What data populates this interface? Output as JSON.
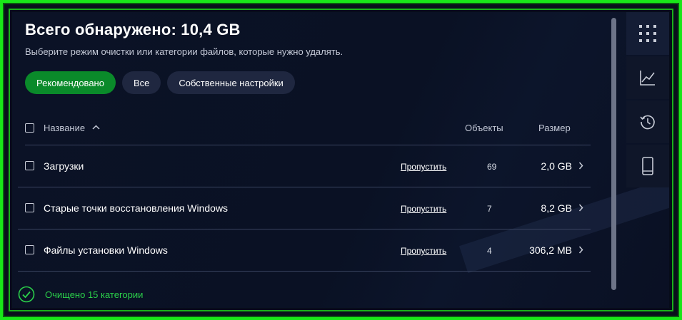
{
  "header": {
    "title": "Всего обнаружено: 10,4 GB",
    "subtitle": "Выберите режим очистки или категории файлов, которые нужно удалять."
  },
  "modes": [
    {
      "label": "Рекомендовано",
      "active": true
    },
    {
      "label": "Все",
      "active": false
    },
    {
      "label": "Собственные настройки",
      "active": false
    }
  ],
  "table": {
    "columns": {
      "name": "Название",
      "objects": "Объекты",
      "size": "Размер"
    },
    "rows": [
      {
        "name": "Загрузки",
        "action": "Пропустить",
        "count": "69",
        "size": "2,0 GB"
      },
      {
        "name": "Старые точки восстановления Windows",
        "action": "Пропустить",
        "count": "7",
        "size": "8,2 GB"
      },
      {
        "name": "Файлы установки Windows",
        "action": "Пропустить",
        "count": "4",
        "size": "306,2 MB"
      }
    ]
  },
  "footer": {
    "status": "Очищено 15 категории"
  },
  "sidebar": {
    "icons": [
      "grid-icon",
      "chart-line-icon",
      "history-icon",
      "phone-icon"
    ]
  },
  "colors": {
    "accent": "#0a8a2a",
    "success": "#2bd14a",
    "frame": "#19e619"
  }
}
